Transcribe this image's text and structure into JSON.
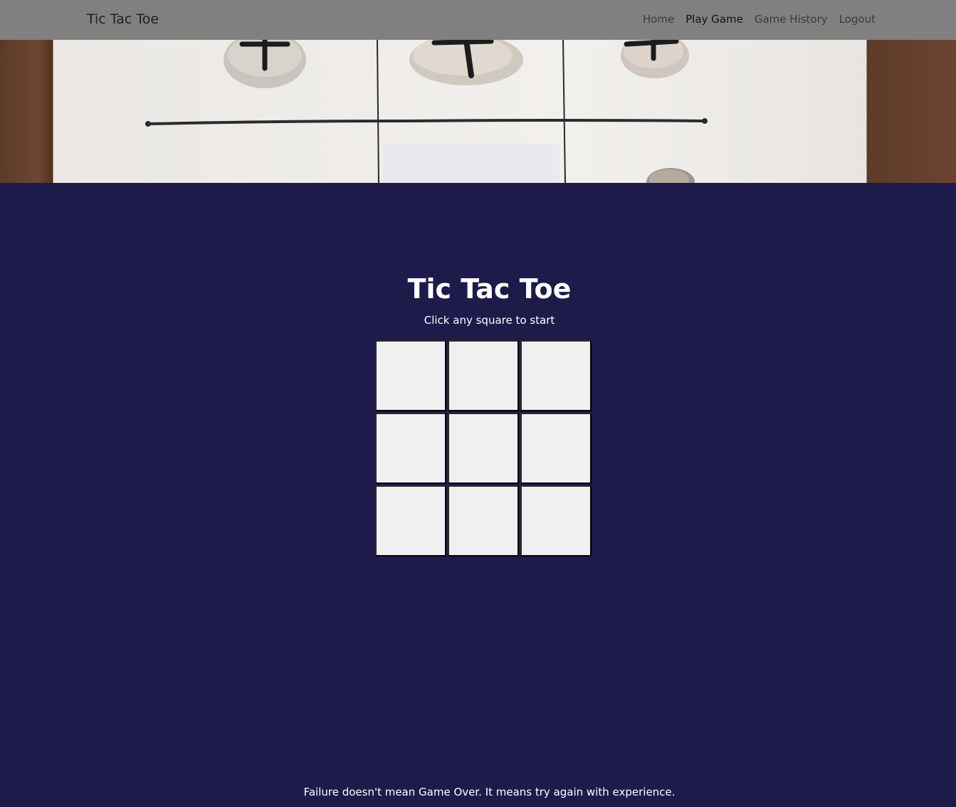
{
  "navbar": {
    "brand": "Tic Tac Toe",
    "links": [
      {
        "label": "Home"
      },
      {
        "label": "Play Game"
      },
      {
        "label": "Game History"
      },
      {
        "label": "Logout"
      }
    ]
  },
  "game": {
    "title": "Tic Tac Toe",
    "instruction": "Click any square to start",
    "cells": [
      "",
      "",
      "",
      "",
      "",
      "",
      "",
      "",
      ""
    ]
  },
  "footer": {
    "quote": "Failure doesn't mean Game Over. It means try again with experience."
  },
  "colors": {
    "navbar_bg": "#808080",
    "page_bg": "#1e1b4b",
    "cell_bg": "#f0f0f0"
  }
}
